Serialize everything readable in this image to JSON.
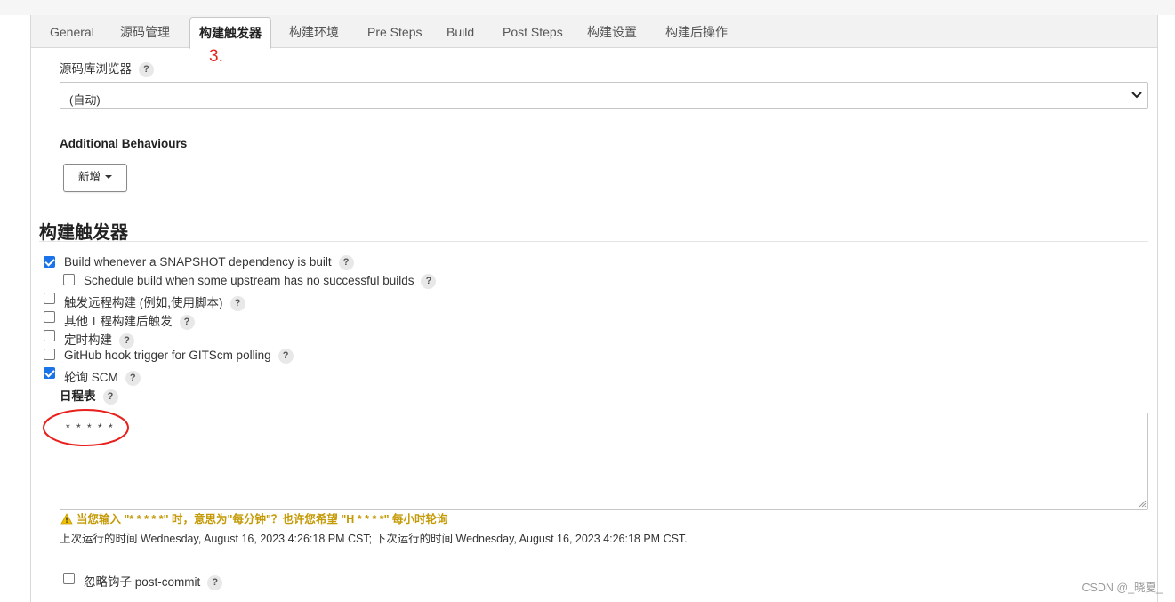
{
  "tabs": [
    "General",
    "源码管理",
    "构建触发器",
    "构建环境",
    "Pre Steps",
    "Build",
    "Post Steps",
    "构建设置",
    "构建后操作"
  ],
  "annotation_number": "3.",
  "scm": {
    "browser_label": "源码库浏览器",
    "browser_value": "(自动)",
    "additional_behaviours": "Additional Behaviours",
    "add_button": "新增"
  },
  "triggers": {
    "title": "构建触发器",
    "items": [
      {
        "label": "Build whenever a SNAPSHOT dependency is built",
        "checked": true
      },
      {
        "label": "Schedule build when some upstream has no successful builds",
        "checked": false
      },
      {
        "label": "触发远程构建 (例如,使用脚本)",
        "checked": false
      },
      {
        "label": "其他工程构建后触发",
        "checked": false
      },
      {
        "label": "定时构建",
        "checked": false
      },
      {
        "label": "GitHub hook trigger for GITScm polling",
        "checked": false
      },
      {
        "label": "轮询 SCM",
        "checked": true
      }
    ],
    "schedule_label": "日程表",
    "schedule_value": "* * * * *",
    "warning": "当您输入 \"* * * * *\" 时，意思为\"每分钟\"？也许您希望 \"H * * * *\" 每小时轮询",
    "run_info": "上次运行的时间 Wednesday, August 16, 2023 4:26:18 PM CST; 下次运行的时间 Wednesday, August 16, 2023 4:26:18 PM CST.",
    "ignore_hooks": {
      "label": "忽略钩子 post-commit",
      "checked": false
    }
  },
  "help_symbol": "?",
  "watermark": "CSDN @_晓夏_",
  "colors": {
    "checkbox_checked": "#1a73e8",
    "warning": "#c49a06",
    "annotation": "#e8211d"
  }
}
